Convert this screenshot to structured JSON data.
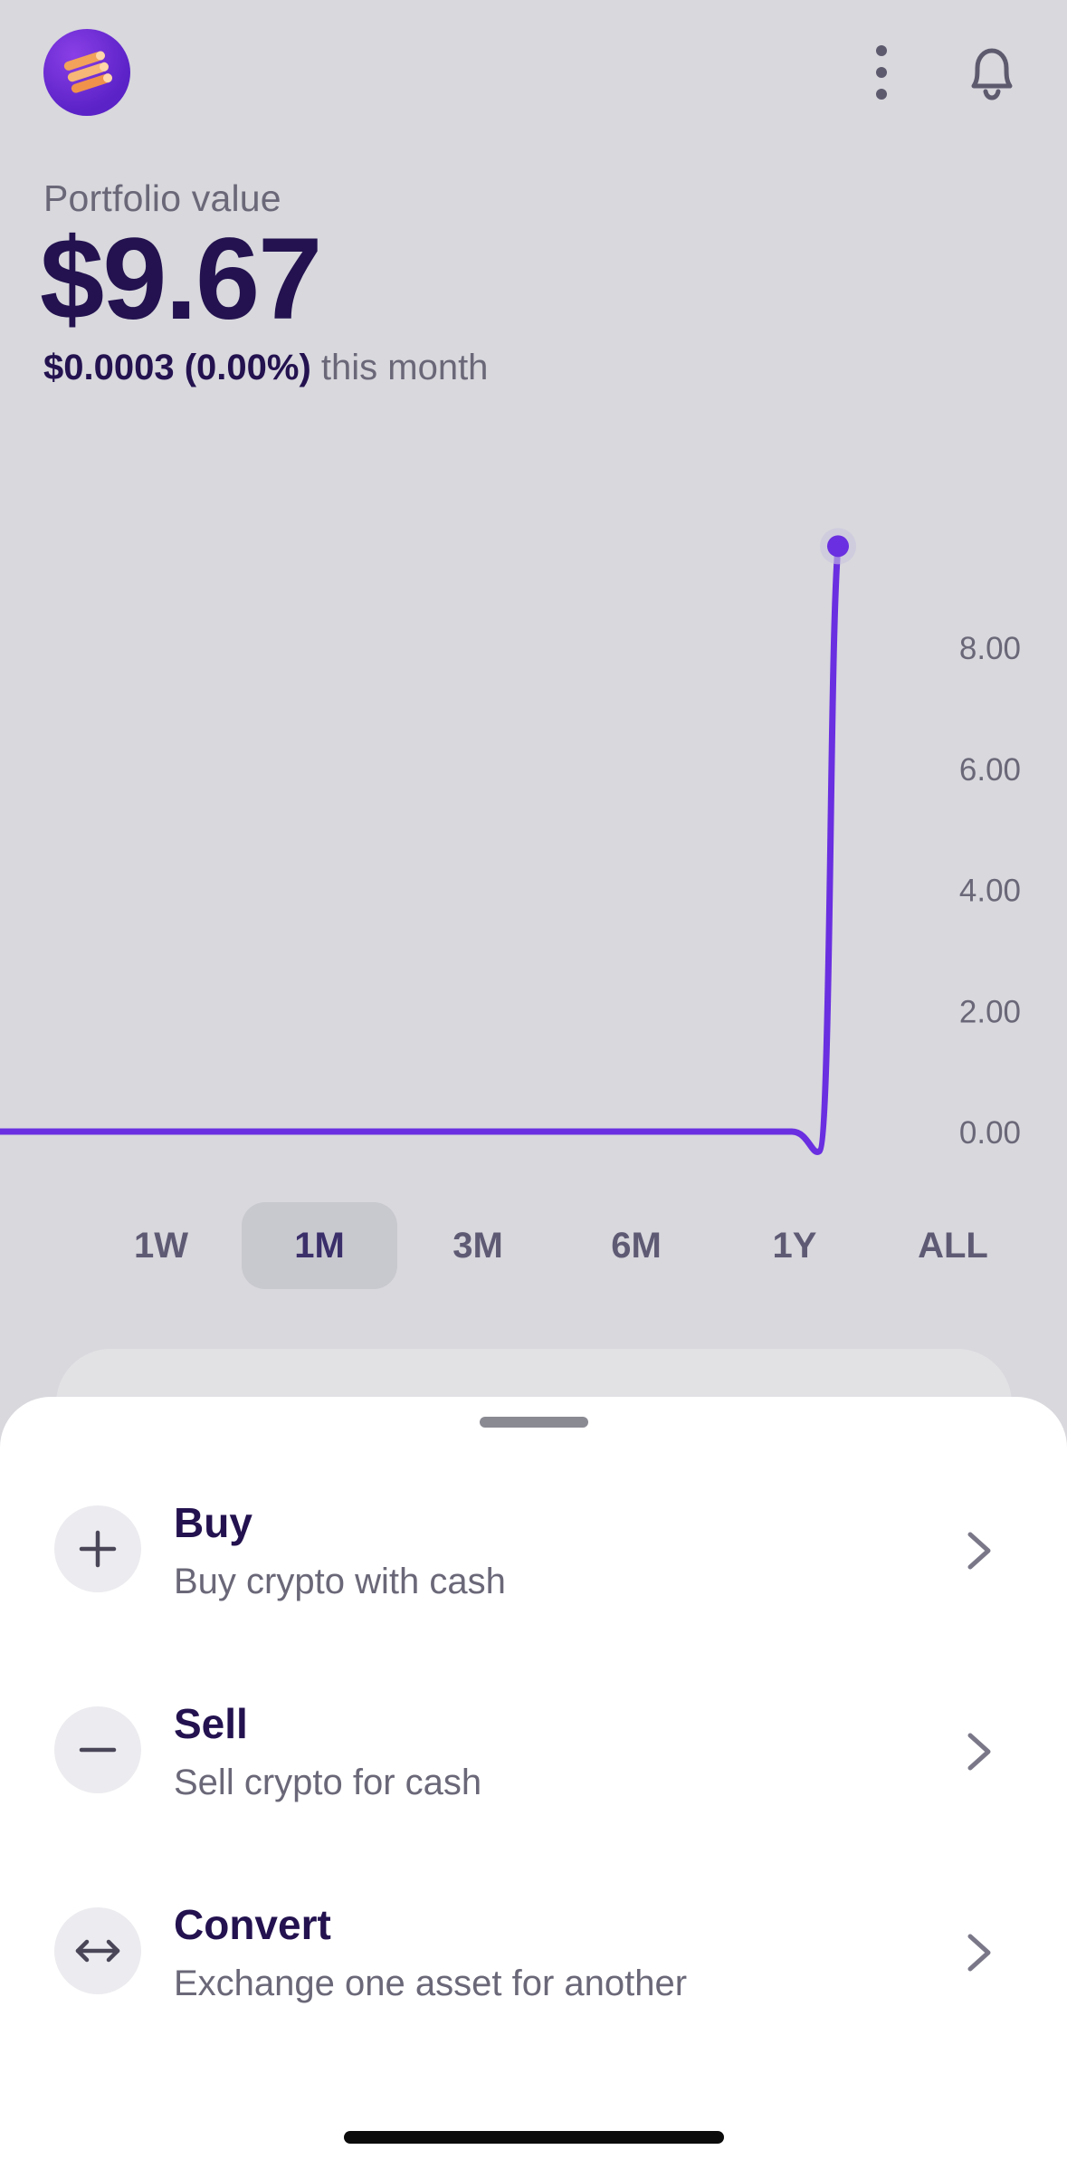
{
  "header": {
    "logo_icon": "coin-stack-icon",
    "more_icon": "vertical-dots-icon",
    "notifications_icon": "bell-icon"
  },
  "portfolio": {
    "label": "Portfolio value",
    "value": "$9.67",
    "change_amount": "$0.0003 (0.00%)",
    "change_period": "this month"
  },
  "chart_data": {
    "type": "line",
    "y_ticks": [
      "8.00",
      "6.00",
      "4.00",
      "2.00",
      "0.00"
    ],
    "ylim": [
      0,
      10
    ],
    "series": [
      {
        "values": [
          0,
          0,
          0,
          0,
          0,
          0,
          0,
          0,
          0,
          0,
          0,
          0,
          0,
          0,
          0,
          0,
          0,
          0,
          0,
          0,
          0,
          0,
          0,
          0,
          0,
          0,
          9.67
        ]
      }
    ],
    "line_color": "#6a2fe0",
    "grid": false
  },
  "ranges": {
    "items": [
      "1W",
      "1M",
      "3M",
      "6M",
      "1Y",
      "ALL"
    ],
    "selected": "1M"
  },
  "actions": [
    {
      "title": "Buy",
      "subtitle": "Buy crypto with cash",
      "icon": "plus-icon"
    },
    {
      "title": "Sell",
      "subtitle": "Sell crypto for cash",
      "icon": "minus-icon"
    },
    {
      "title": "Convert",
      "subtitle": "Exchange one asset for another",
      "icon": "swap-arrows-icon"
    }
  ],
  "colors": {
    "accent": "#6a2fe0",
    "primary_text": "#23124f",
    "secondary_text": "#6a6878",
    "background": "#d8d8dd"
  }
}
